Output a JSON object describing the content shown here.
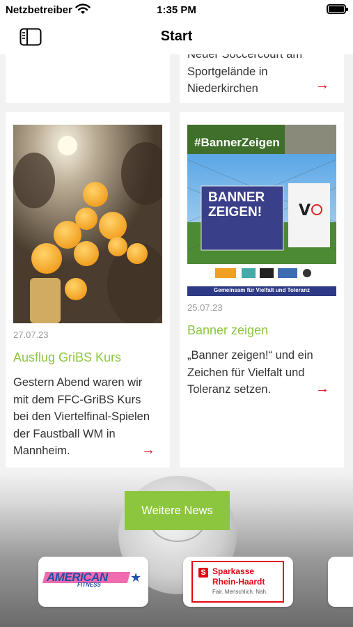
{
  "status": {
    "carrier": "Netzbetreiber",
    "time": "1:35 PM"
  },
  "nav": {
    "title": "Start"
  },
  "top_right_card": {
    "lines": [
      "Neuer Soccercourt am",
      "Sportgelände in",
      "Niederkirchen"
    ]
  },
  "cards": [
    {
      "date": "27.07.23",
      "title": "Ausflug GriBS Kurs",
      "lines": [
        "Gestern Abend waren wir",
        "mit dem FFC-GriBS Kurs",
        "bei den Viertelfinal-Spielen",
        "der Faustball WM in",
        "Mannheim."
      ]
    },
    {
      "date": "25.07.23",
      "title": "Banner zeigen",
      "lines": [
        "„Banner zeigen!“ und ein",
        "Zeichen für Vielfalt und",
        "Toleranz setzen."
      ]
    }
  ],
  "banner_image": {
    "hashtag": "#BannerZeigen",
    "headline_1": "BANNER",
    "headline_2": "ZEIGEN!",
    "footer": "Gemeinsam für Vielfalt und Toleranz"
  },
  "more_button": {
    "label": "Weitere News"
  },
  "sponsors": [
    {
      "name": "AMERICAN FITNESS",
      "logo_word_1": "AMERICAN",
      "logo_word_2": "FITNESS"
    },
    {
      "name": "Sparkasse Rhein-Haardt",
      "line_1": "Sparkasse",
      "line_2": "Rhein-Haardt",
      "tagline": "Fair. Menschlich. Nah."
    }
  ],
  "colors": {
    "accent": "#8cc63f",
    "arrow": "#e30613"
  },
  "icons": {
    "sidebar": "sidebar-icon",
    "arrow": "arrow-right-icon",
    "wifi": "wifi-icon"
  }
}
